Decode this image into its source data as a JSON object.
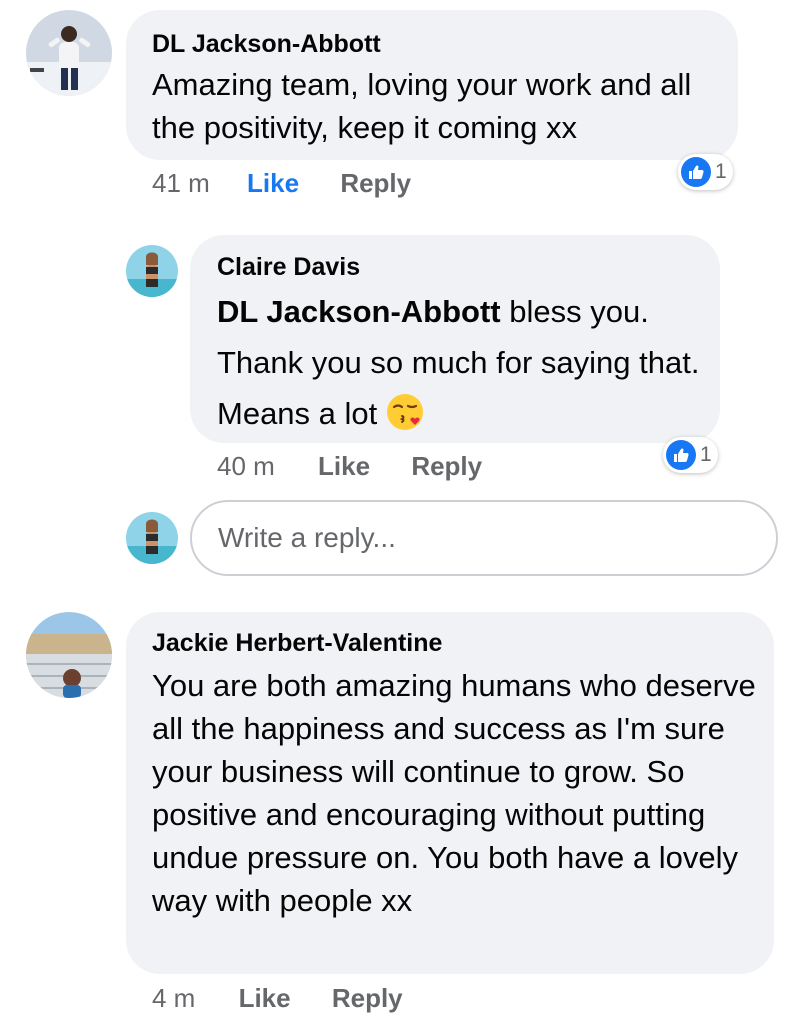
{
  "comments": [
    {
      "author": "DL Jackson-Abbott",
      "text": "Amazing team, loving your work and all the positivity, keep it coming xx",
      "time": "41 m",
      "like_label": "Like",
      "reply_label": "Reply",
      "reaction_count": "1",
      "liked": true
    },
    {
      "author": "Claire Davis",
      "mention": "DL Jackson-Abbott",
      "text": " bless you. Thank you so much for saying that. Means a lot",
      "emoji": "face-blowing-a-kiss",
      "time": "40 m",
      "like_label": "Like",
      "reply_label": "Reply",
      "reaction_count": "1"
    },
    {
      "author": "Jackie Herbert-Valentine",
      "text": "You are both amazing humans who deserve all the happiness and success as I'm sure your business will continue to grow. So positive and encouraging without putting undue pressure on. You both have a lovely way with people xx",
      "time": "4 m",
      "like_label": "Like",
      "reply_label": "Reply"
    }
  ],
  "reply_input": {
    "placeholder": "Write a reply..."
  },
  "colors": {
    "like_active": "#1877f2",
    "bubble": "#f0f2f5",
    "meta": "#65676b"
  }
}
